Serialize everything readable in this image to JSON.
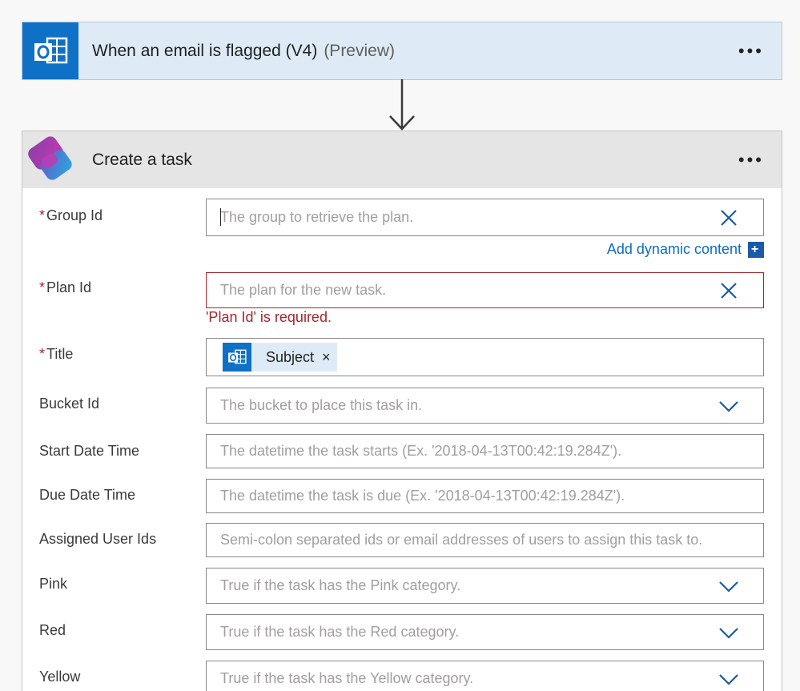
{
  "trigger": {
    "title": "When an email is flagged (V4)",
    "preview": "(Preview)",
    "more": "•••",
    "icon": "outlook-icon",
    "color": "#0f71c6"
  },
  "action": {
    "title": "Create a task",
    "more": "•••",
    "icon": "planner-icon"
  },
  "fields": {
    "group_id": {
      "label": "Group Id",
      "required": "*",
      "placeholder": "The group to retrieve the plan."
    },
    "dynamic_content": "Add dynamic content",
    "plan_id": {
      "label": "Plan Id",
      "required": "*",
      "placeholder": "The plan for the new task.",
      "error": "'Plan Id' is required."
    },
    "title": {
      "label": "Title",
      "required": "*",
      "token": "Subject",
      "token_close": "×"
    },
    "bucket_id": {
      "label": "Bucket Id",
      "placeholder": "The bucket to place this task in."
    },
    "start_date": {
      "label": "Start Date Time",
      "placeholder": "The datetime the task starts (Ex. '2018-04-13T00:42:19.284Z')."
    },
    "due_date": {
      "label": "Due Date Time",
      "placeholder": "The datetime the task is due (Ex. '2018-04-13T00:42:19.284Z')."
    },
    "assigned": {
      "label": "Assigned User Ids",
      "placeholder": "Semi-colon separated ids or email addresses of users to assign this task to."
    },
    "pink": {
      "label": "Pink",
      "placeholder": "True if the task has the Pink category."
    },
    "red": {
      "label": "Red",
      "placeholder": "True if the task has the Red category."
    },
    "yellow": {
      "label": "Yellow",
      "placeholder": "True if the task has the Yellow category."
    }
  },
  "colors": {
    "accent": "#0f6cbd",
    "error": "#a4262c"
  }
}
